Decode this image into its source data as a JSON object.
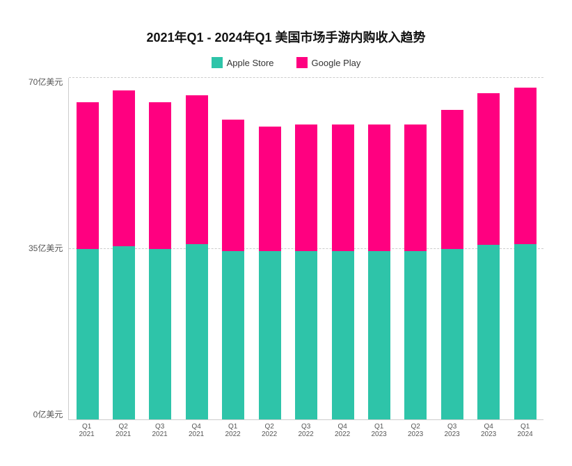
{
  "title": "2021年Q1 - 2024年Q1 美国市场手游内购收入趋势",
  "legend": {
    "apple_label": "Apple Store",
    "google_label": "Google Play",
    "apple_color": "#2EC4A9",
    "google_color": "#FF0080"
  },
  "yAxis": {
    "labels": [
      "70亿美元",
      "35亿美元",
      "0亿美元"
    ]
  },
  "bars": [
    {
      "quarter": "Q1 2021",
      "apple": 35,
      "google": 30
    },
    {
      "quarter": "Q2 2021",
      "apple": 35.5,
      "google": 32
    },
    {
      "quarter": "Q3 2021",
      "apple": 35,
      "google": 30
    },
    {
      "quarter": "Q4 2021",
      "apple": 36,
      "google": 30.5
    },
    {
      "quarter": "Q1 2022",
      "apple": 34.5,
      "google": 27
    },
    {
      "quarter": "Q2 2022",
      "apple": 34.5,
      "google": 25.5
    },
    {
      "quarter": "Q3 2022",
      "apple": 34.5,
      "google": 26
    },
    {
      "quarter": "Q4 2022",
      "apple": 34.5,
      "google": 26
    },
    {
      "quarter": "Q1 2023",
      "apple": 34.5,
      "google": 26
    },
    {
      "quarter": "Q2 2023",
      "apple": 34.5,
      "google": 26
    },
    {
      "quarter": "Q3 2023",
      "apple": 35,
      "google": 28.5
    },
    {
      "quarter": "Q4 2023",
      "apple": 35.8,
      "google": 31
    },
    {
      "quarter": "Q1 2024",
      "apple": 36,
      "google": 32
    }
  ],
  "maxValue": 70
}
